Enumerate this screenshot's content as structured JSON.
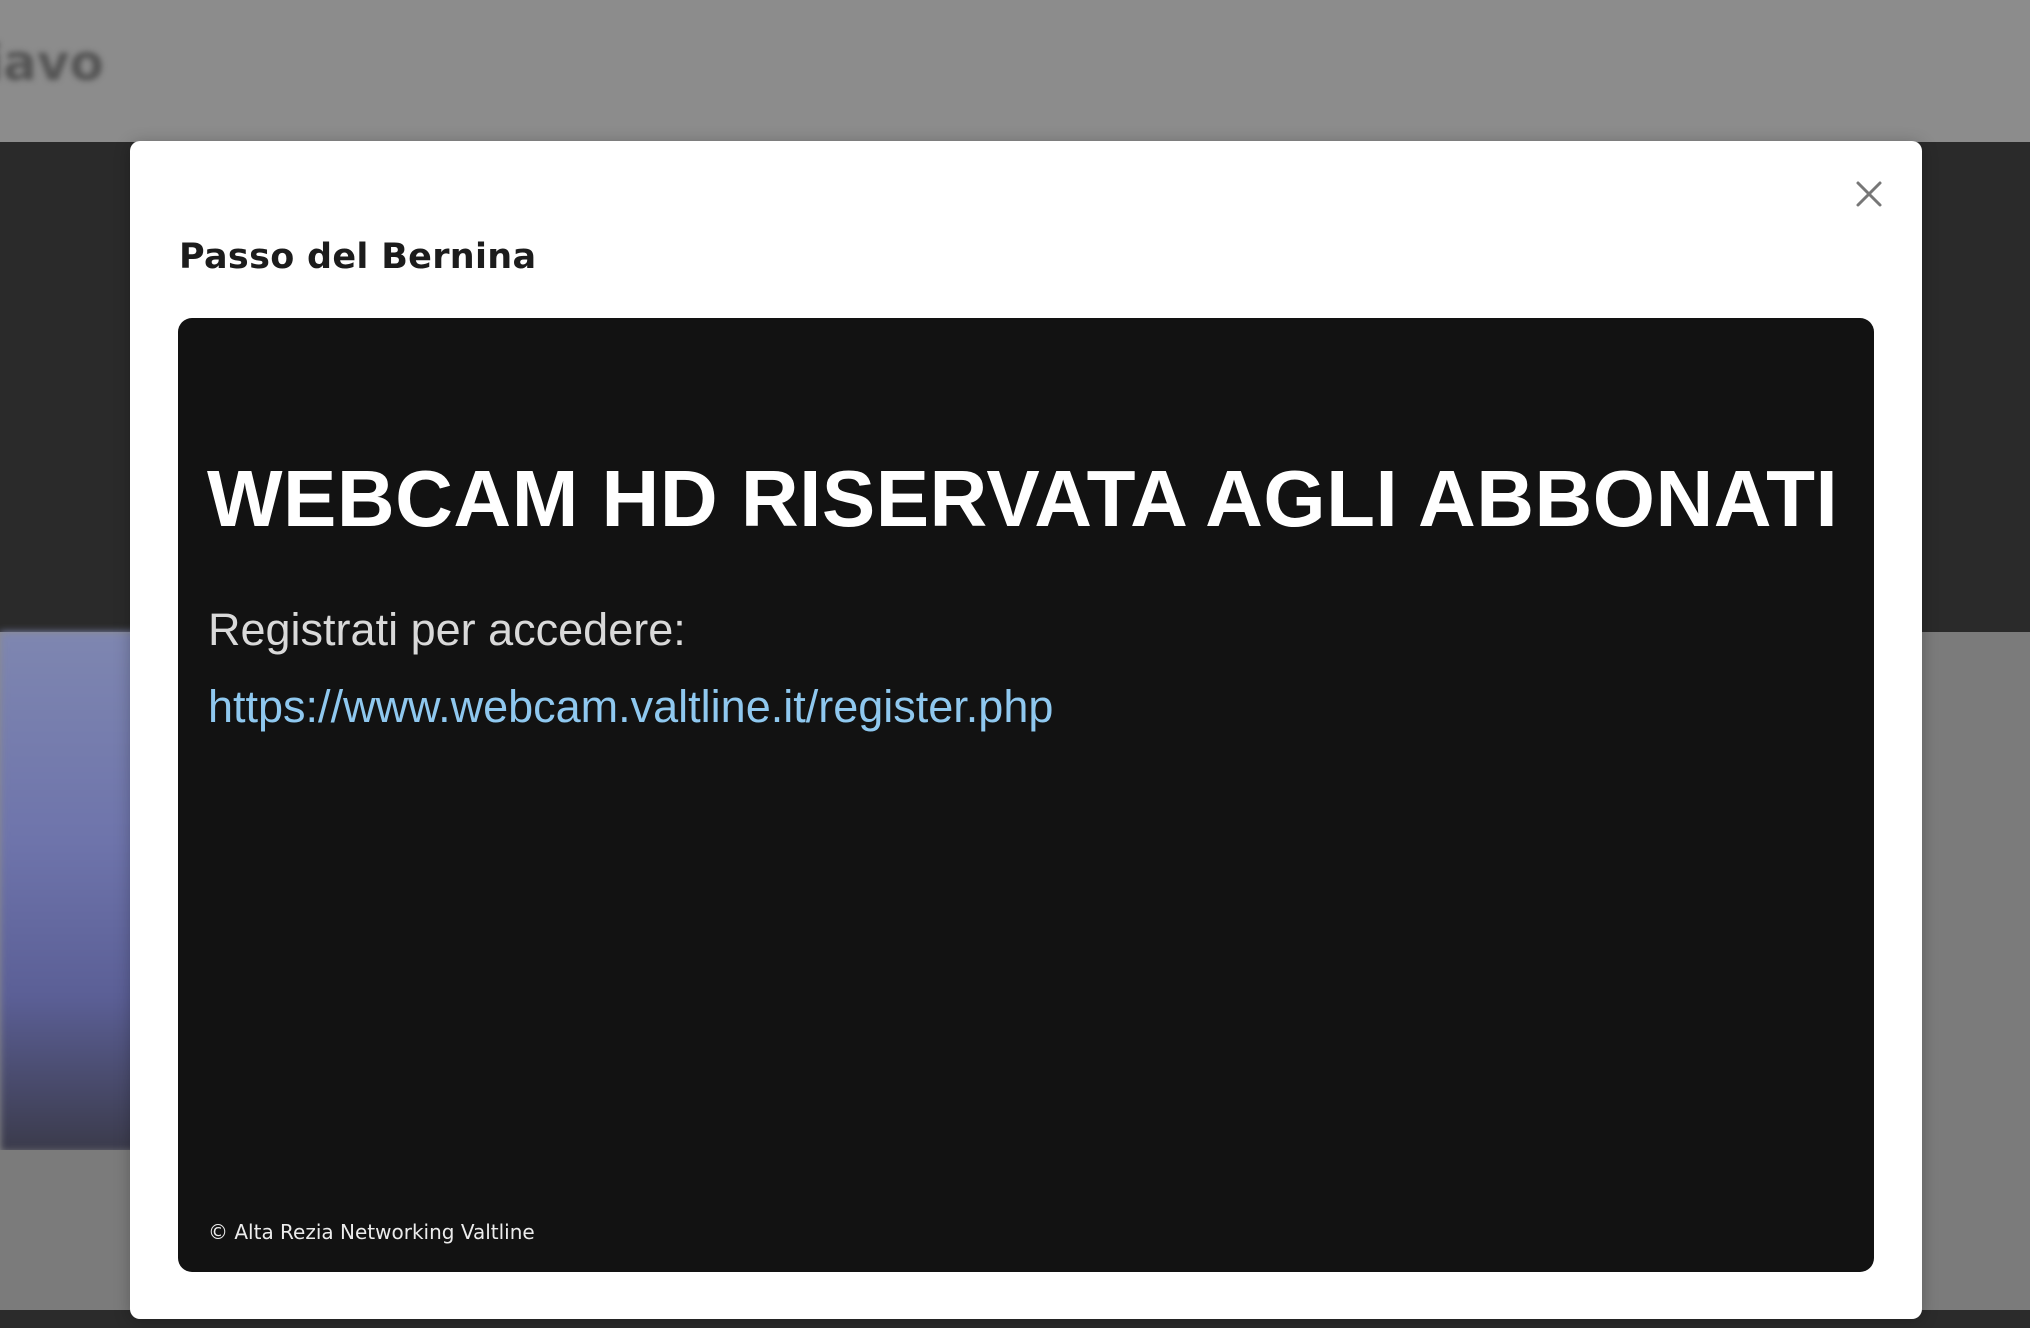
{
  "background": {
    "brand_fragment": "iavo"
  },
  "modal": {
    "title": "Passo del Bernina",
    "close_icon": "close-icon",
    "viewer": {
      "heading": "WEBCAM HD RISERVATA AGLI ABBONATI",
      "subtext": "Registrati per accedere:",
      "link_text": "https://www.webcam.valtline.it/register.php",
      "copyright": "© Alta Rezia Networking Valtline"
    }
  },
  "colors": {
    "overlay": "#8c8c8c",
    "modal_bg": "#ffffff",
    "viewer_bg": "#121212",
    "link": "#8fc8ef",
    "heading": "#ffffff"
  }
}
